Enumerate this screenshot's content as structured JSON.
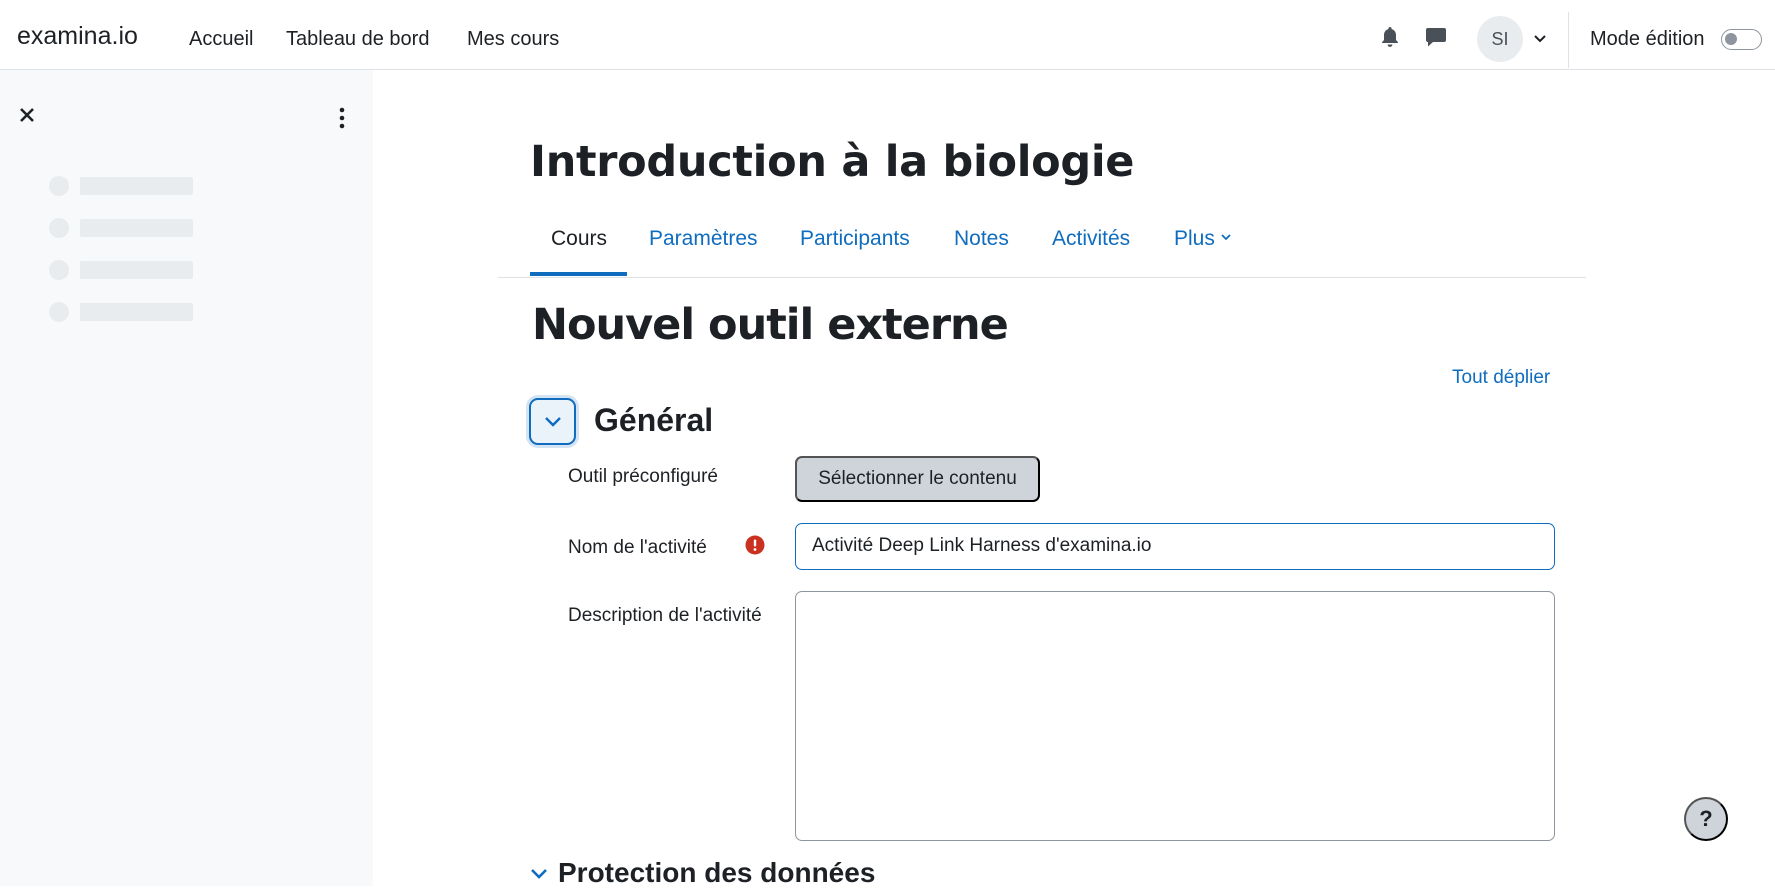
{
  "header": {
    "brand": "examina.io",
    "nav": [
      {
        "label": "Accueil"
      },
      {
        "label": "Tableau de bord"
      },
      {
        "label": "Mes cours"
      }
    ],
    "icons": {
      "notifications": "bell-icon",
      "messages": "chat-icon",
      "user_menu": "chevron-down-icon"
    },
    "user_initials": "SI",
    "edit_mode_label": "Mode édition",
    "edit_mode_on": false
  },
  "drawer": {
    "close_icon": "close-icon",
    "more_icon": "more-vertical-icon",
    "skeleton_rows": 4
  },
  "course": {
    "title": "Introduction à la biologie",
    "tabs": [
      {
        "label": "Cours",
        "active": true
      },
      {
        "label": "Paramètres",
        "active": false
      },
      {
        "label": "Participants",
        "active": false
      },
      {
        "label": "Notes",
        "active": false
      },
      {
        "label": "Activités",
        "active": false
      },
      {
        "label": "Plus",
        "active": false
      }
    ]
  },
  "page": {
    "heading": "Nouvel outil externe",
    "expand_all": "Tout déplier"
  },
  "section_general": {
    "title": "Général",
    "fields": {
      "preconfigured_tool": {
        "label": "Outil préconfiguré",
        "button": "Sélectionner le contenu"
      },
      "activity_name": {
        "label": "Nom de l'activité",
        "value": "Activité Deep Link Harness d'examina.io",
        "required_icon": "required-icon"
      },
      "activity_description": {
        "label": "Description de l'activité",
        "value": ""
      }
    }
  },
  "section_privacy": {
    "title": "Protection des données"
  },
  "help": {
    "label": "?"
  },
  "colors": {
    "link": "#0f6cbf",
    "text": "#1d2125",
    "drawer_bg": "#f8f9fa",
    "required": "#ca3120",
    "button_secondary": "#ced4da"
  }
}
